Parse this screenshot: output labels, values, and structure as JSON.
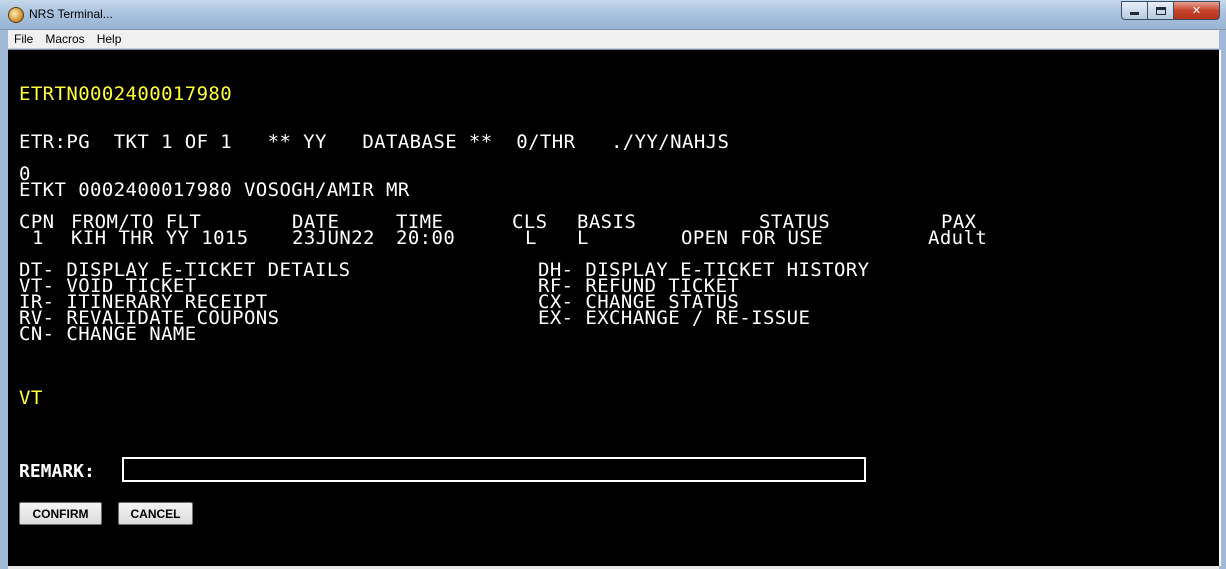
{
  "window": {
    "title": "NRS Terminal...",
    "buttons": {
      "minimize": "minimize",
      "maximize": "maximize",
      "close": "✕"
    }
  },
  "menu": [
    "File",
    "Macros",
    "Help"
  ],
  "terminal": {
    "header_code": "ETRTN0002400017980",
    "status_line": "ETR:PG  TKT 1 OF 1   ** YY   DATABASE **  0/THR   ./YY/NAHJS",
    "zero_line": "0",
    "ticket_line": "ETKT 0002400017980 VOSOGH/AMIR MR",
    "columns": {
      "cpn": "CPN",
      "from_to_flt": "FROM/TO FLT",
      "date": "DATE",
      "time": "TIME",
      "cls": "CLS",
      "basis": "BASIS",
      "status": "STATUS",
      "pax": "PAX"
    },
    "coupon": {
      "cpn": "1",
      "from_to_flt": "KIH THR YY 1015",
      "date": "23JUN22",
      "time": "20:00",
      "cls": "L",
      "basis": "L",
      "status": "OPEN FOR USE",
      "pax": "Adult"
    },
    "commands_left": [
      "DT- DISPLAY E-TICKET DETAILS",
      "VT- VOID TICKET",
      "IR- ITINERARY RECEIPT",
      "RV- REVALIDATE COUPONS",
      "CN- CHANGE NAME"
    ],
    "commands_right": [
      "DH- DISPLAY E-TICKET HISTORY",
      "RF- REFUND TICKET",
      "CX- CHANGE STATUS",
      "EX- EXCHANGE / RE-ISSUE"
    ],
    "command_entered": "VT",
    "remark_label": "REMARK:",
    "remark_value": "",
    "confirm_label": "CONFIRM",
    "cancel_label": "CANCEL"
  },
  "colors": {
    "terminal_bg": "#000000",
    "text": "#ffffff",
    "highlight": "#ffff3a"
  }
}
